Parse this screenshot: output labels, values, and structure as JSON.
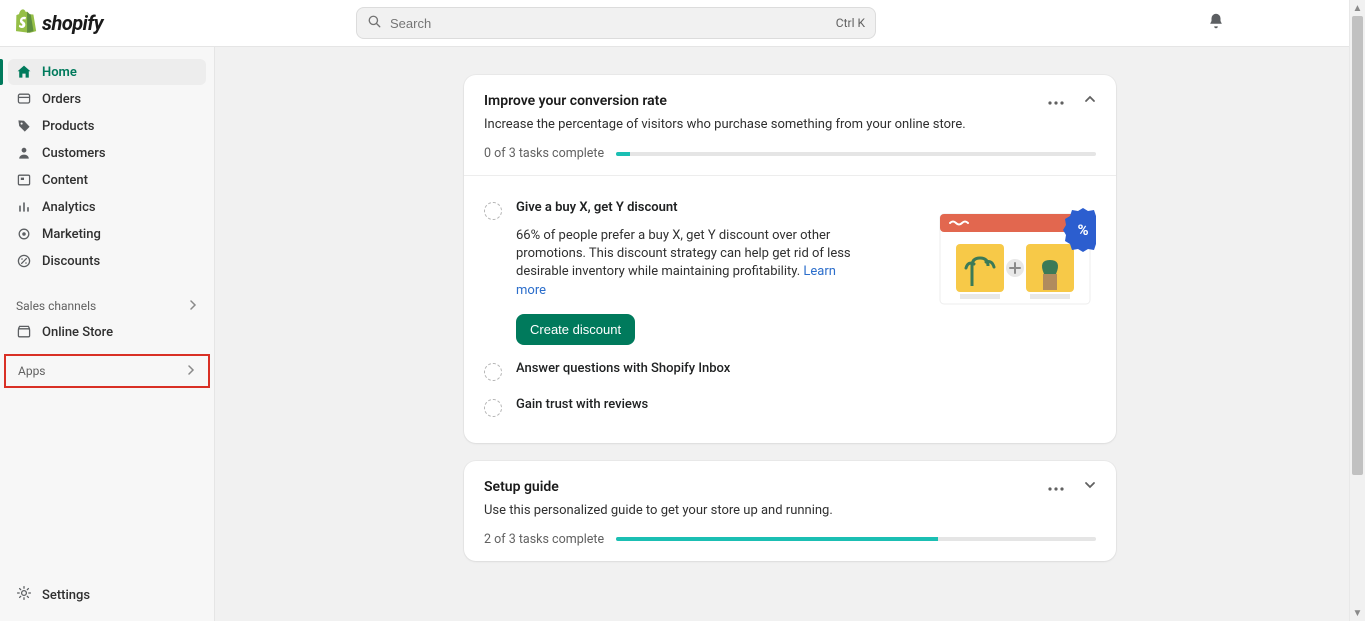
{
  "brand": "shopify",
  "search": {
    "placeholder": "Search",
    "shortcut": "Ctrl K"
  },
  "sidebar": {
    "items": [
      {
        "label": "Home",
        "active": true
      },
      {
        "label": "Orders"
      },
      {
        "label": "Products"
      },
      {
        "label": "Customers"
      },
      {
        "label": "Content"
      },
      {
        "label": "Analytics"
      },
      {
        "label": "Marketing"
      },
      {
        "label": "Discounts"
      }
    ],
    "sales_channels_label": "Sales channels",
    "online_store": "Online Store",
    "apps_label": "Apps",
    "settings_label": "Settings"
  },
  "cards": {
    "conversion": {
      "title": "Improve your conversion rate",
      "subtitle": "Increase the percentage of visitors who purchase something from your online store.",
      "progress_label": "0 of 3 tasks complete",
      "progress_pct": 3,
      "tasks": [
        {
          "title": "Give a buy X, get Y discount",
          "desc_prefix": "66% of people prefer a buy X, get Y discount over other promotions. This discount strategy can help get rid of less desirable inventory while maintaining profitability. ",
          "learn_more": "Learn more",
          "cta": "Create discount",
          "expanded": true
        },
        {
          "title": "Answer questions with Shopify Inbox"
        },
        {
          "title": "Gain trust with reviews"
        }
      ]
    },
    "setup": {
      "title": "Setup guide",
      "subtitle": "Use this personalized guide to get your store up and running.",
      "progress_label": "2 of 3 tasks complete",
      "progress_pct": 67
    }
  }
}
